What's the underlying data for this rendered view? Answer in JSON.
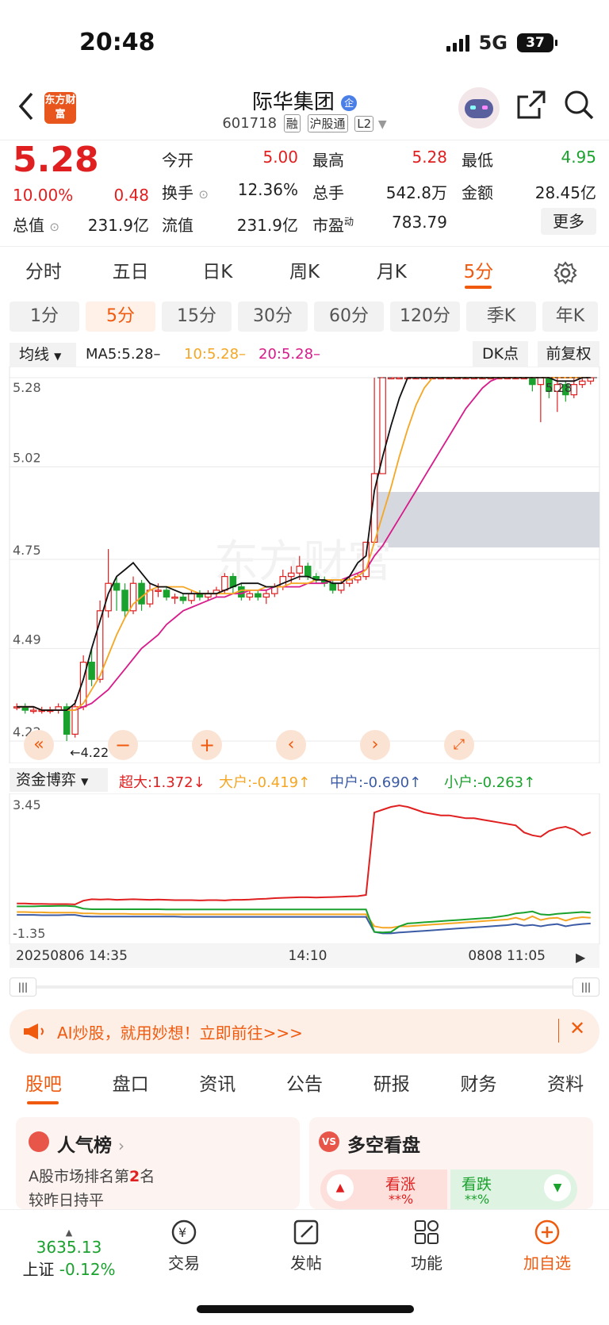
{
  "status": {
    "time": "20:48",
    "network": "5G",
    "battery": "37"
  },
  "header": {
    "stock_name": "际华集团",
    "badge": "企",
    "code": "601718",
    "tags": [
      "融",
      "沪股通",
      "L2"
    ],
    "logo_text": "东方财富"
  },
  "quote": {
    "price": "5.28",
    "change_pct": "10.00%",
    "change": "0.48",
    "open_label": "今开",
    "open": "5.00",
    "high_label": "最高",
    "high": "5.28",
    "low_label": "最低",
    "low": "4.95",
    "turnover_label": "换手",
    "turnover": "12.36%",
    "volume_label": "总手",
    "volume": "542.8万",
    "amount_label": "金额",
    "amount": "28.45亿",
    "mktcap_label": "总值",
    "mktcap": "231.9亿",
    "float_label": "流值",
    "float": "231.9亿",
    "pe_label": "市盈",
    "pe_sup": "动",
    "pe": "783.79",
    "more": "更多"
  },
  "period_tabs": [
    "分时",
    "五日",
    "日K",
    "周K",
    "月K",
    "5分"
  ],
  "minute_tabs": [
    "1分",
    "5分",
    "15分",
    "30分",
    "60分",
    "120分",
    "季K",
    "年K"
  ],
  "chart_header": {
    "indicator": "均线",
    "ma5": "MA5:5.28–",
    "ma10": "10:5.28–",
    "ma20": "20:5.28–",
    "dk": "DK点",
    "adjust": "前复权"
  },
  "colors": {
    "red": "#e02020",
    "green": "#1ba22e",
    "ma5": "#111111",
    "ma10": "#f5a623",
    "ma20": "#d81b8a",
    "blue": "#3b5ba5",
    "accent": "#f05a0e"
  },
  "chart_data": [
    {
      "type": "candlestick",
      "y_ticks": [
        "5.28",
        "5.02",
        "4.75",
        "4.49",
        "4.22"
      ],
      "ylim": [
        4.22,
        5.28
      ],
      "low_marker": "4.22",
      "last_marker": "5.28",
      "series": [
        {
          "name": "MA5",
          "value": "5.28"
        },
        {
          "name": "10",
          "value": "5.28"
        },
        {
          "name": "20",
          "value": "5.28"
        }
      ],
      "ma5_values": [
        4.32,
        4.32,
        4.32,
        4.31,
        4.31,
        4.31,
        4.31,
        4.33,
        4.4,
        4.49,
        4.57,
        4.65,
        4.7,
        4.72,
        4.74,
        4.71,
        4.68,
        4.67,
        4.67,
        4.66,
        4.65,
        4.65,
        4.65,
        4.65,
        4.65,
        4.66,
        4.67,
        4.68,
        4.68,
        4.68,
        4.67,
        4.67,
        4.68,
        4.69,
        4.7,
        4.7,
        4.69,
        4.69,
        4.68,
        4.68,
        4.7,
        4.74,
        4.76,
        4.95,
        5.05,
        5.14,
        5.22,
        5.28,
        5.28,
        5.28,
        5.28,
        5.28,
        5.28,
        5.28,
        5.28,
        5.28,
        5.28,
        5.28,
        5.28,
        5.28,
        5.28,
        5.28,
        5.28,
        5.28,
        5.28,
        5.27,
        5.27,
        5.27,
        5.28,
        5.28
      ],
      "ma10_values": [
        4.32,
        4.32,
        4.32,
        4.31,
        4.31,
        4.31,
        4.31,
        4.31,
        4.33,
        4.37,
        4.41,
        4.47,
        4.53,
        4.58,
        4.62,
        4.64,
        4.66,
        4.67,
        4.67,
        4.67,
        4.67,
        4.66,
        4.65,
        4.65,
        4.65,
        4.65,
        4.65,
        4.66,
        4.66,
        4.66,
        4.67,
        4.67,
        4.67,
        4.68,
        4.68,
        4.68,
        4.69,
        4.69,
        4.69,
        4.69,
        4.69,
        4.7,
        4.72,
        4.8,
        4.88,
        4.96,
        5.05,
        5.13,
        5.2,
        5.25,
        5.28,
        5.28,
        5.28,
        5.28,
        5.28,
        5.28,
        5.28,
        5.28,
        5.28,
        5.28,
        5.28,
        5.28,
        5.28,
        5.28,
        5.28,
        5.28,
        5.28,
        5.28,
        5.28,
        5.28
      ],
      "ma20_values": [
        4.32,
        4.32,
        4.32,
        4.31,
        4.31,
        4.31,
        4.31,
        4.31,
        4.32,
        4.33,
        4.35,
        4.37,
        4.4,
        4.43,
        4.46,
        4.49,
        4.51,
        4.53,
        4.56,
        4.58,
        4.6,
        4.61,
        4.62,
        4.63,
        4.64,
        4.64,
        4.65,
        4.65,
        4.66,
        4.66,
        4.66,
        4.67,
        4.67,
        4.67,
        4.67,
        4.68,
        4.68,
        4.68,
        4.69,
        4.69,
        4.7,
        4.71,
        4.72,
        4.76,
        4.79,
        4.83,
        4.87,
        4.91,
        4.95,
        4.99,
        5.03,
        5.07,
        5.11,
        5.15,
        5.19,
        5.22,
        5.25,
        5.27,
        5.28,
        5.28,
        5.28,
        5.28,
        5.28,
        5.28,
        5.28,
        5.28,
        5.28,
        5.28,
        5.28,
        5.28
      ],
      "candles": [
        [
          4.32,
          4.32,
          4.33,
          4.31
        ],
        [
          4.32,
          4.31,
          4.33,
          4.3
        ],
        [
          4.31,
          4.31,
          4.32,
          4.3
        ],
        [
          4.31,
          4.31,
          4.32,
          4.3
        ],
        [
          4.31,
          4.31,
          4.32,
          4.3
        ],
        [
          4.31,
          4.32,
          4.33,
          4.3
        ],
        [
          4.32,
          4.24,
          4.33,
          4.22
        ],
        [
          4.24,
          4.32,
          4.34,
          4.23
        ],
        [
          4.32,
          4.45,
          4.47,
          4.31
        ],
        [
          4.45,
          4.4,
          4.49,
          4.38
        ],
        [
          4.4,
          4.6,
          4.63,
          4.39
        ],
        [
          4.6,
          4.68,
          4.78,
          4.58
        ],
        [
          4.68,
          4.66,
          4.7,
          4.6
        ],
        [
          4.66,
          4.6,
          4.68,
          4.58
        ],
        [
          4.6,
          4.68,
          4.7,
          4.59
        ],
        [
          4.68,
          4.62,
          4.69,
          4.6
        ],
        [
          4.62,
          4.66,
          4.68,
          4.61
        ],
        [
          4.66,
          4.66,
          4.68,
          4.64
        ],
        [
          4.66,
          4.64,
          4.67,
          4.63
        ],
        [
          4.64,
          4.64,
          4.65,
          4.62
        ],
        [
          4.64,
          4.63,
          4.65,
          4.62
        ],
        [
          4.63,
          4.65,
          4.66,
          4.62
        ],
        [
          4.65,
          4.64,
          4.66,
          4.63
        ],
        [
          4.64,
          4.65,
          4.66,
          4.63
        ],
        [
          4.65,
          4.66,
          4.67,
          4.64
        ],
        [
          4.66,
          4.7,
          4.71,
          4.65
        ],
        [
          4.7,
          4.67,
          4.71,
          4.65
        ],
        [
          4.67,
          4.64,
          4.68,
          4.63
        ],
        [
          4.64,
          4.65,
          4.66,
          4.63
        ],
        [
          4.65,
          4.64,
          4.66,
          4.63
        ],
        [
          4.64,
          4.65,
          4.66,
          4.62
        ],
        [
          4.65,
          4.67,
          4.68,
          4.64
        ],
        [
          4.67,
          4.7,
          4.72,
          4.66
        ],
        [
          4.7,
          4.71,
          4.73,
          4.68
        ],
        [
          4.71,
          4.73,
          4.76,
          4.69
        ],
        [
          4.73,
          4.7,
          4.74,
          4.69
        ],
        [
          4.7,
          4.69,
          4.71,
          4.68
        ],
        [
          4.69,
          4.68,
          4.7,
          4.67
        ],
        [
          4.68,
          4.66,
          4.69,
          4.65
        ],
        [
          4.66,
          4.68,
          4.69,
          4.65
        ],
        [
          4.68,
          4.69,
          4.7,
          4.67
        ],
        [
          4.69,
          4.7,
          4.71,
          4.68
        ],
        [
          4.7,
          4.8,
          4.8,
          4.69
        ],
        [
          4.8,
          5.0,
          5.28,
          4.99
        ],
        [
          5.0,
          5.28,
          5.28,
          5.0
        ],
        [
          5.28,
          5.28,
          5.28,
          5.28
        ],
        [
          5.28,
          5.28,
          5.28,
          5.28
        ],
        [
          5.28,
          5.28,
          5.28,
          5.28
        ],
        [
          5.28,
          5.28,
          5.28,
          5.28
        ],
        [
          5.28,
          5.28,
          5.28,
          5.28
        ],
        [
          5.28,
          5.28,
          5.28,
          5.28
        ],
        [
          5.28,
          5.28,
          5.28,
          5.28
        ],
        [
          5.28,
          5.28,
          5.28,
          5.28
        ],
        [
          5.28,
          5.28,
          5.28,
          5.28
        ],
        [
          5.28,
          5.28,
          5.28,
          5.28
        ],
        [
          5.28,
          5.28,
          5.28,
          5.28
        ],
        [
          5.28,
          5.28,
          5.28,
          5.28
        ],
        [
          5.28,
          5.28,
          5.28,
          5.28
        ],
        [
          5.28,
          5.28,
          5.28,
          5.28
        ],
        [
          5.28,
          5.28,
          5.28,
          5.28
        ],
        [
          5.28,
          5.28,
          5.28,
          5.28
        ],
        [
          5.28,
          5.28,
          5.28,
          5.28
        ],
        [
          5.28,
          5.26,
          5.28,
          5.24
        ],
        [
          5.26,
          5.28,
          5.28,
          5.15
        ],
        [
          5.28,
          5.24,
          5.28,
          5.22
        ],
        [
          5.24,
          5.26,
          5.28,
          5.18
        ],
        [
          5.26,
          5.23,
          5.27,
          5.21
        ],
        [
          5.23,
          5.26,
          5.28,
          5.22
        ],
        [
          5.26,
          5.27,
          5.28,
          5.25
        ],
        [
          5.27,
          5.28,
          5.28,
          5.26
        ]
      ]
    },
    {
      "type": "line",
      "indicator": "资金博弈",
      "y_ticks": [
        "3.45",
        "-1.35"
      ],
      "ylim": [
        -1.35,
        3.45
      ],
      "x_ticks": [
        "20250806 14:35",
        "14:10",
        "0808 11:05"
      ],
      "series": [
        {
          "name": "超大",
          "value": "1.372",
          "arrow": "↓",
          "color": "#e02020",
          "values": [
            -0.2,
            -0.2,
            -0.21,
            -0.21,
            -0.22,
            -0.22,
            -0.22,
            -0.23,
            -0.1,
            -0.05,
            -0.06,
            -0.05,
            -0.07,
            -0.06,
            -0.05,
            -0.06,
            -0.07,
            -0.06,
            -0.07,
            -0.08,
            -0.08,
            -0.08,
            -0.09,
            -0.08,
            -0.08,
            -0.09,
            -0.07,
            -0.07,
            -0.06,
            -0.04,
            -0.03,
            -0.01,
            0.0,
            0.01,
            0.02,
            0.02,
            0.01,
            0.02,
            0.03,
            0.04,
            0.05,
            0.06,
            0.1,
            3.0,
            3.1,
            3.2,
            3.25,
            3.2,
            3.1,
            3.0,
            2.95,
            2.9,
            2.9,
            2.85,
            2.8,
            2.8,
            2.75,
            2.7,
            2.65,
            2.6,
            2.55,
            2.3,
            2.2,
            2.15,
            2.35,
            2.45,
            2.5,
            2.4,
            2.2,
            2.3
          ]
        },
        {
          "name": "大户",
          "value": "-0.419",
          "arrow": "↑",
          "color": "#f5a623",
          "values": [
            -0.5,
            -0.5,
            -0.51,
            -0.51,
            -0.52,
            -0.52,
            -0.52,
            -0.52,
            -0.55,
            -0.55,
            -0.56,
            -0.56,
            -0.56,
            -0.56,
            -0.57,
            -0.57,
            -0.57,
            -0.57,
            -0.58,
            -0.58,
            -0.58,
            -0.58,
            -0.58,
            -0.58,
            -0.58,
            -0.58,
            -0.58,
            -0.58,
            -0.58,
            -0.58,
            -0.58,
            -0.58,
            -0.58,
            -0.58,
            -0.58,
            -0.58,
            -0.58,
            -0.58,
            -0.58,
            -0.58,
            -0.58,
            -0.58,
            -0.58,
            -1.0,
            -1.05,
            -1.05,
            -1.0,
            -1.0,
            -0.98,
            -0.96,
            -0.94,
            -0.92,
            -0.9,
            -0.88,
            -0.86,
            -0.84,
            -0.82,
            -0.8,
            -0.78,
            -0.76,
            -0.7,
            -0.78,
            -0.65,
            -0.78,
            -0.72,
            -0.7,
            -0.8,
            -0.72,
            -0.68,
            -0.7
          ]
        },
        {
          "name": "中户",
          "value": "-0.690",
          "arrow": "↑",
          "color": "#3b5ba5",
          "values": [
            -0.6,
            -0.6,
            -0.6,
            -0.61,
            -0.61,
            -0.61,
            -0.6,
            -0.6,
            -0.65,
            -0.66,
            -0.66,
            -0.66,
            -0.66,
            -0.66,
            -0.66,
            -0.66,
            -0.66,
            -0.66,
            -0.66,
            -0.66,
            -0.67,
            -0.67,
            -0.67,
            -0.67,
            -0.67,
            -0.67,
            -0.67,
            -0.67,
            -0.67,
            -0.67,
            -0.67,
            -0.67,
            -0.67,
            -0.67,
            -0.67,
            -0.67,
            -0.67,
            -0.67,
            -0.67,
            -0.67,
            -0.67,
            -0.67,
            -0.67,
            -1.2,
            -1.25,
            -1.25,
            -1.22,
            -1.2,
            -1.18,
            -1.16,
            -1.14,
            -1.12,
            -1.1,
            -1.08,
            -1.06,
            -1.04,
            -1.02,
            -1.0,
            -0.98,
            -0.96,
            -0.92,
            -0.98,
            -0.95,
            -1.0,
            -0.95,
            -0.92,
            -1.0,
            -0.95,
            -0.92,
            -0.9
          ]
        },
        {
          "name": "小户",
          "value": "-0.263",
          "arrow": "↑",
          "color": "#1ba22e",
          "values": [
            -0.3,
            -0.3,
            -0.3,
            -0.29,
            -0.29,
            -0.28,
            -0.28,
            -0.3,
            -0.38,
            -0.4,
            -0.4,
            -0.4,
            -0.4,
            -0.4,
            -0.4,
            -0.4,
            -0.4,
            -0.4,
            -0.41,
            -0.41,
            -0.41,
            -0.41,
            -0.41,
            -0.41,
            -0.41,
            -0.41,
            -0.41,
            -0.41,
            -0.41,
            -0.41,
            -0.41,
            -0.41,
            -0.41,
            -0.41,
            -0.41,
            -0.41,
            -0.41,
            -0.41,
            -0.41,
            -0.41,
            -0.41,
            -0.41,
            -0.41,
            -1.2,
            -1.22,
            -1.2,
            -1.0,
            -0.9,
            -0.88,
            -0.86,
            -0.84,
            -0.82,
            -0.8,
            -0.78,
            -0.76,
            -0.74,
            -0.72,
            -0.7,
            -0.66,
            -0.62,
            -0.55,
            -0.52,
            -0.48,
            -0.58,
            -0.6,
            -0.56,
            -0.54,
            -0.52,
            -0.5,
            -0.52
          ]
        }
      ]
    }
  ],
  "ad": {
    "text": "AI炒股，就用妙想！立即前往>>>"
  },
  "bottom_tabs": [
    "股吧",
    "盘口",
    "资讯",
    "公告",
    "研报",
    "财务",
    "资料"
  ],
  "cards": {
    "popularity": {
      "title": "人气榜",
      "line1_prefix": "A股市场排名第",
      "rank": "2",
      "line1_suffix": "名",
      "line2": "较昨日持平"
    },
    "bullbear": {
      "title": "多空看盘",
      "up_label": "看涨",
      "up_value": "**%",
      "down_label": "看跌",
      "down_value": "**%"
    }
  },
  "footer": {
    "index_value": "3635.13",
    "index_name": "上证",
    "index_change": "-0.12%",
    "buttons": [
      "交易",
      "发帖",
      "功能",
      "加自选"
    ]
  }
}
